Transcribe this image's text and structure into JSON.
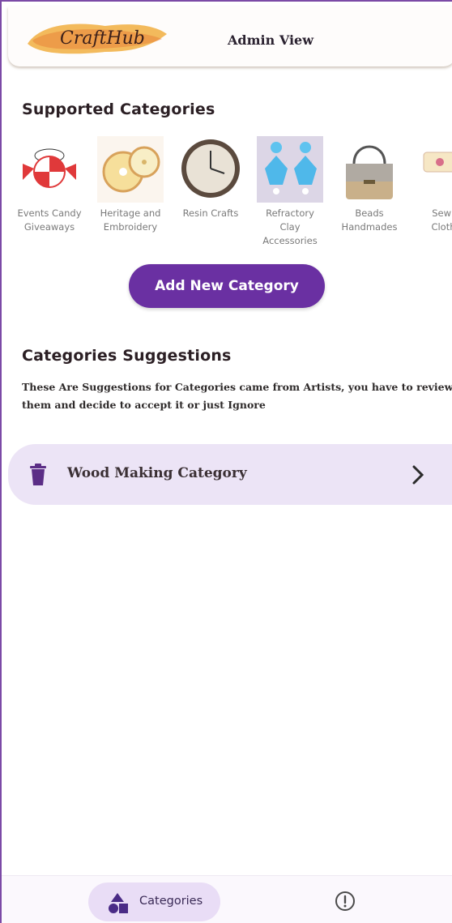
{
  "header": {
    "logo_text": "CraftHub",
    "title": "Admin View"
  },
  "supported": {
    "heading": "Supported Categories",
    "categories": [
      {
        "label": "Events Candy Giveaways",
        "icon": "candy-icon"
      },
      {
        "label": "Heritage and Embroidery",
        "icon": "embroidery-hoop-icon"
      },
      {
        "label": "Resin Crafts",
        "icon": "resin-clock-icon"
      },
      {
        "label": "Refractory Clay Accessories",
        "icon": "clay-earrings-icon"
      },
      {
        "label": "Beads Handmades",
        "icon": "beaded-bag-icon"
      },
      {
        "label": "Sewing Clothes",
        "icon": "sewing-icon"
      }
    ],
    "add_button": "Add New Category"
  },
  "suggestions": {
    "heading": "Categories Suggestions",
    "description_line1": "These Are Suggestions for Categories came from Artists, you have to review",
    "description_line2": "them and decide to accept it or just Ignore",
    "items": [
      {
        "label": "Wood Making Category",
        "icon": "trash-icon",
        "trailing_icon": "chevron-right-icon"
      }
    ]
  },
  "bottom_nav": {
    "items": [
      {
        "label": "Categories",
        "icon": "shapes-icon",
        "active": true
      },
      {
        "label": "",
        "icon": "alert-circle-icon",
        "active": false
      }
    ]
  },
  "colors": {
    "primary": "#6a30a2",
    "card_bg": "#ece4f6",
    "nav_active_bg": "#e9ddf6"
  }
}
